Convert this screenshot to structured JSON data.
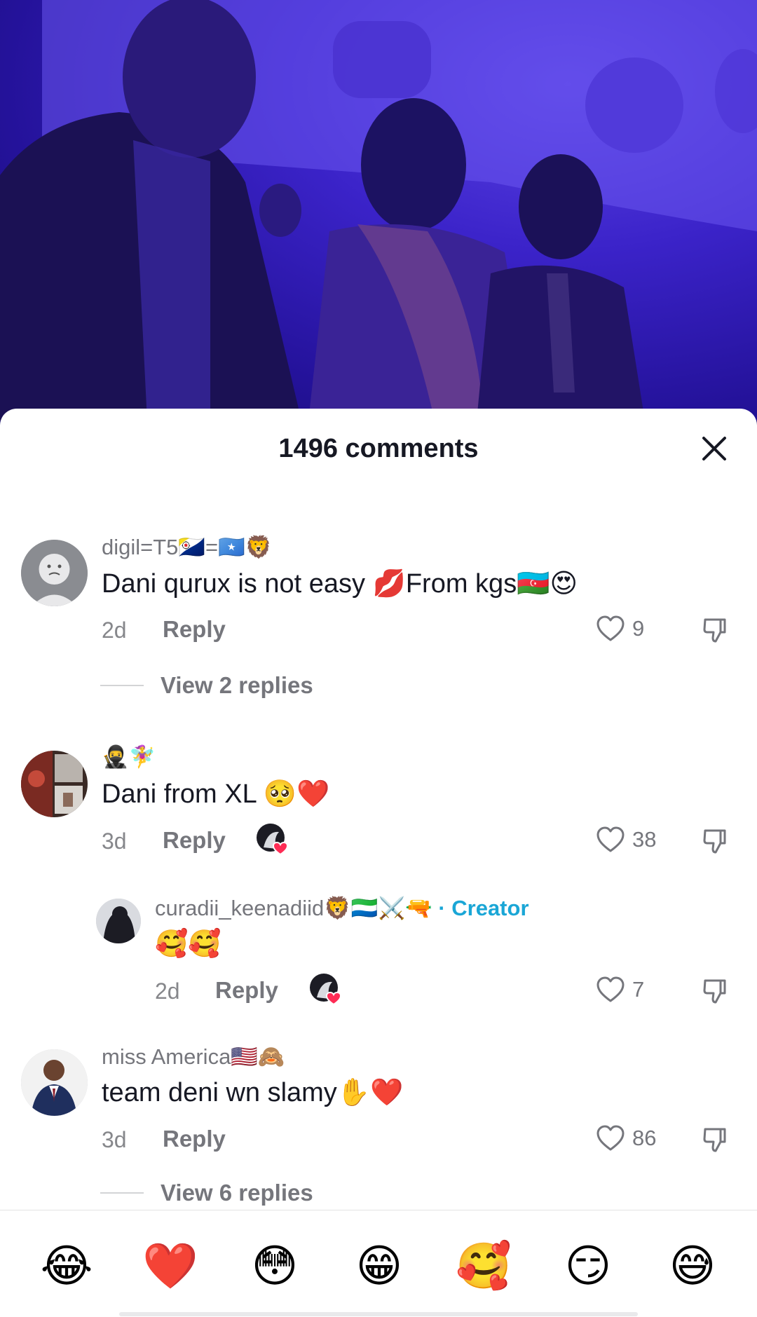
{
  "sheet": {
    "title": "1496 comments"
  },
  "comments": [
    {
      "username": "digil=T5🇧🇶=🇸🇴🦁",
      "text": "Dani qurux is not easy 💋From kgs🇦🇿😍",
      "time": "2d",
      "reply_label": "Reply",
      "likes": "9",
      "view_replies": "View 2 replies"
    },
    {
      "username": "🥷🧚‍♀️",
      "text": "Dani from XL 🥺❤️",
      "time": "3d",
      "reply_label": "Reply",
      "likes": "38"
    },
    {
      "username": "curadii_keenadiid🦁🇸🇱⚔️🔫",
      "creator_label": "· Creator",
      "text": "🥰🥰",
      "time": "2d",
      "reply_label": "Reply",
      "likes": "7"
    },
    {
      "username": "miss America🇺🇸🙈",
      "text": "team deni wn slamy✋❤️",
      "time": "3d",
      "reply_label": "Reply",
      "likes": "86",
      "view_replies": "View 6 replies"
    }
  ],
  "quick_emojis": [
    "😂",
    "❤️",
    "😳",
    "😁",
    "🥰",
    "😏",
    "😅"
  ],
  "icons": {
    "close": "close-icon",
    "like": "heart-outline-icon",
    "dislike": "thumbs-down-icon",
    "creator_liked": "creator-liked-heart-icon"
  },
  "colors": {
    "creator_accent": "#1aa6d6",
    "secondary_text": "#75767c",
    "primary_text": "#161823"
  }
}
